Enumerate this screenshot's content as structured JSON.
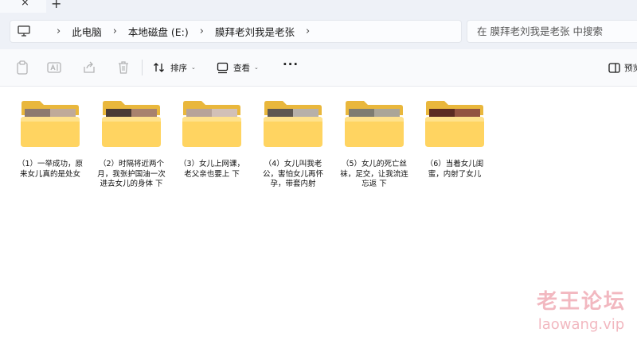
{
  "tabs": {
    "close_glyph": "×",
    "new_tab_glyph": "+"
  },
  "breadcrumb": {
    "items": [
      "此电脑",
      "本地磁盘 (E:)",
      "膜拜老刘我是老张"
    ],
    "separator": "›"
  },
  "search": {
    "placeholder": "在 膜拜老刘我是老张 中搜索"
  },
  "toolbar": {
    "sort_label": "排序",
    "view_label": "查看",
    "more_glyph": "···",
    "preview_label": "预览",
    "caret_glyph": "⌄"
  },
  "folders": [
    {
      "name": "（1）一举成功，原来女儿真的是处女",
      "thumb": "#8d7a6f",
      "thumb2": "#c9b3a1"
    },
    {
      "name": "（2）时隔将近两个月，我张护国油一次进去女儿的身体 下",
      "thumb": "#4a3b35",
      "thumb2": "#b98f78"
    },
    {
      "name": "（3）女儿上网课，老父亲也要上 下",
      "thumb": "#b7a399",
      "thumb2": "#d7c6bc"
    },
    {
      "name": "（4）女儿叫我老公，害怕女儿再怀孕，带套内射",
      "thumb": "#5e5751",
      "thumb2": "#c7bfb8"
    },
    {
      "name": "（5）女儿的死亡丝袜，足交，让我流连忘返 下",
      "thumb": "#7e7c71",
      "thumb2": "#b2ad9f"
    },
    {
      "name": "（6）当着女儿闺蜜，内射了女儿",
      "thumb": "#5b2b22",
      "thumb2": "#9c5a47"
    }
  ],
  "watermark": {
    "cn": "老王论坛",
    "en": "laowang.vip"
  }
}
